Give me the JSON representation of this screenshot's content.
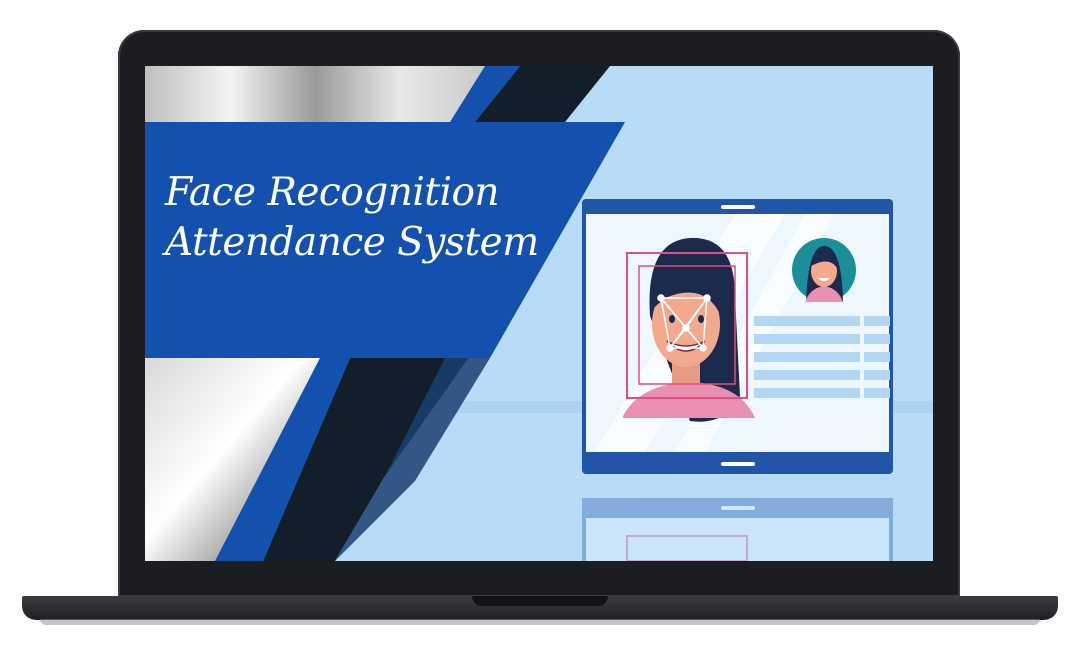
{
  "banner": {
    "title_line_1": "Face Recognition",
    "title_line_2": "Attendance System"
  },
  "colors": {
    "primary_blue": "#1450ad",
    "dark_navy": "#121f2a",
    "sky_background": "#b8dcf8",
    "frame_pink": "#e04f7f"
  }
}
